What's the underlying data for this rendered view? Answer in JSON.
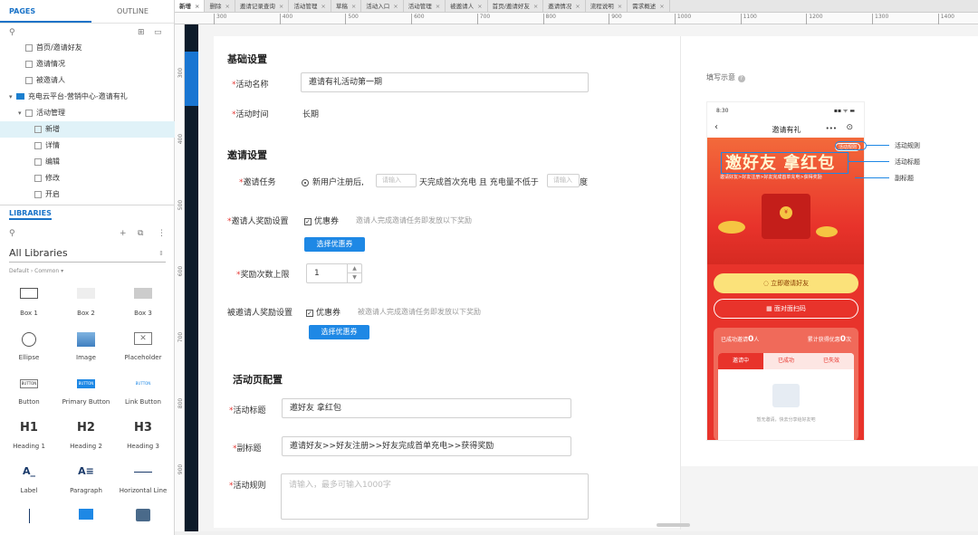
{
  "left_panel": {
    "tabs": [
      "PAGES",
      "OUTLINE"
    ],
    "tree": [
      {
        "label": "首页/邀请好友",
        "indent": 28,
        "type": "page"
      },
      {
        "label": "邀请情况",
        "indent": 28,
        "type": "page"
      },
      {
        "label": "被邀请人",
        "indent": 28,
        "type": "page"
      },
      {
        "label": "充电云平台-营销中心-邀请有礼",
        "indent": 10,
        "type": "folder"
      },
      {
        "label": "活动管理",
        "indent": 20,
        "type": "page-parent"
      },
      {
        "label": "新增",
        "indent": 38,
        "type": "page",
        "selected": true
      },
      {
        "label": "详情",
        "indent": 38,
        "type": "page"
      },
      {
        "label": "编辑",
        "indent": 38,
        "type": "page"
      },
      {
        "label": "修改",
        "indent": 38,
        "type": "page"
      },
      {
        "label": "开启",
        "indent": 38,
        "type": "page"
      }
    ],
    "libraries_label": "LIBRARIES",
    "library_select": "All Libraries",
    "library_sub": "Default › Common ▾",
    "widgets": [
      {
        "label": "Box 1",
        "icon": "box-outline"
      },
      {
        "label": "Box 2",
        "icon": "box-light"
      },
      {
        "label": "Box 3",
        "icon": "box-gray"
      },
      {
        "label": "Ellipse",
        "icon": "ellipse"
      },
      {
        "label": "Image",
        "icon": "image"
      },
      {
        "label": "Placeholder",
        "icon": "placeholder"
      },
      {
        "label": "Button",
        "icon": "button",
        "text": "BUTTON"
      },
      {
        "label": "Primary Button",
        "icon": "primary-button",
        "text": "BUTTON"
      },
      {
        "label": "Link Button",
        "icon": "link-button",
        "text": "BUTTON"
      },
      {
        "label": "Heading 1",
        "icon": "heading",
        "text": "H1"
      },
      {
        "label": "Heading 2",
        "icon": "heading",
        "text": "H2"
      },
      {
        "label": "Heading 3",
        "icon": "heading",
        "text": "H3"
      },
      {
        "label": "Label",
        "icon": "label",
        "text": "A_"
      },
      {
        "label": "Paragraph",
        "icon": "paragraph",
        "text": "A≡"
      },
      {
        "label": "Horizontal Line",
        "icon": "hline"
      }
    ]
  },
  "doc_tabs": [
    "新增",
    "删除",
    "邀请记录查询",
    "活动管理",
    "草稿",
    "活动入口",
    "活动管理",
    "被邀请人",
    "首页/邀请好友",
    "邀请情况",
    "流程说明",
    "需求概述"
  ],
  "ruler_top": [
    "300",
    "400",
    "500",
    "600",
    "700",
    "800",
    "900",
    "1000",
    "1100",
    "1200",
    "1300",
    "1400"
  ],
  "ruler_left": [
    "300",
    "400",
    "500",
    "600",
    "700",
    "800",
    "900"
  ],
  "form": {
    "basic_title": "基础设置",
    "activity_name_label": "活动名称",
    "activity_name_value": "邀请有礼活动第一期",
    "activity_time_label": "活动时间",
    "activity_time_value": "长期",
    "invite_title": "邀请设置",
    "invite_task_label": "邀请任务",
    "invite_task_text1": "新用户注册后,",
    "invite_task_input_ph": "请输入",
    "invite_task_text2": "天完成首次充电 且 充电量不低于",
    "invite_task_text3": "度",
    "inviter_reward_label": "邀请人奖励设置",
    "coupon_label": "优惠券",
    "inviter_hint": "邀请人完成邀请任务即发放以下奖励",
    "select_coupon_btn": "选择优惠券",
    "reward_limit_label": "奖励次数上限",
    "reward_limit_value": "1",
    "invitee_reward_label": "被邀请人奖励设置",
    "invitee_hint": "被邀请人完成邀请任务即发放以下奖励",
    "page_config_title": "活动页配置",
    "activity_title_label": "活动标题",
    "activity_title_value": "邀好友 拿红包",
    "subtitle_label": "副标题",
    "subtitle_value": "邀请好友>>好友注册>>好友完成首单充电>>获得奖励",
    "rules_label": "活动规则",
    "rules_ph": "请输入，最多可输入1000字"
  },
  "preview": {
    "label": "填写示意",
    "time": "8:30",
    "signal": "▪▪ ᯤ ▬",
    "title": "邀请有礼",
    "rules_chip": "活动规则",
    "hero_title": "邀好友 拿红包",
    "hero_sub": "邀请好友>好友注册>好友完成首单充电>获得奖励",
    "btn_invite": "立即邀请好友",
    "btn_qr": "面对面扫码",
    "stat_left_prefix": "已成功邀请",
    "stat_left_num": "0",
    "stat_left_suffix": "人",
    "stat_right_prefix": "累计获得优惠",
    "stat_right_num": "0",
    "stat_right_suffix": "次",
    "tabs": [
      "邀请中",
      "已成功",
      "已失效"
    ],
    "empty_text": "暂无邀请，快去分享给好友吧",
    "annotations": [
      "活动规则",
      "活动标题",
      "副标题"
    ],
    "colors": {
      "red": "#e8332b",
      "orange": "#f56b2a",
      "yellow": "#fbe27a",
      "blue": "#1e88e5"
    }
  }
}
